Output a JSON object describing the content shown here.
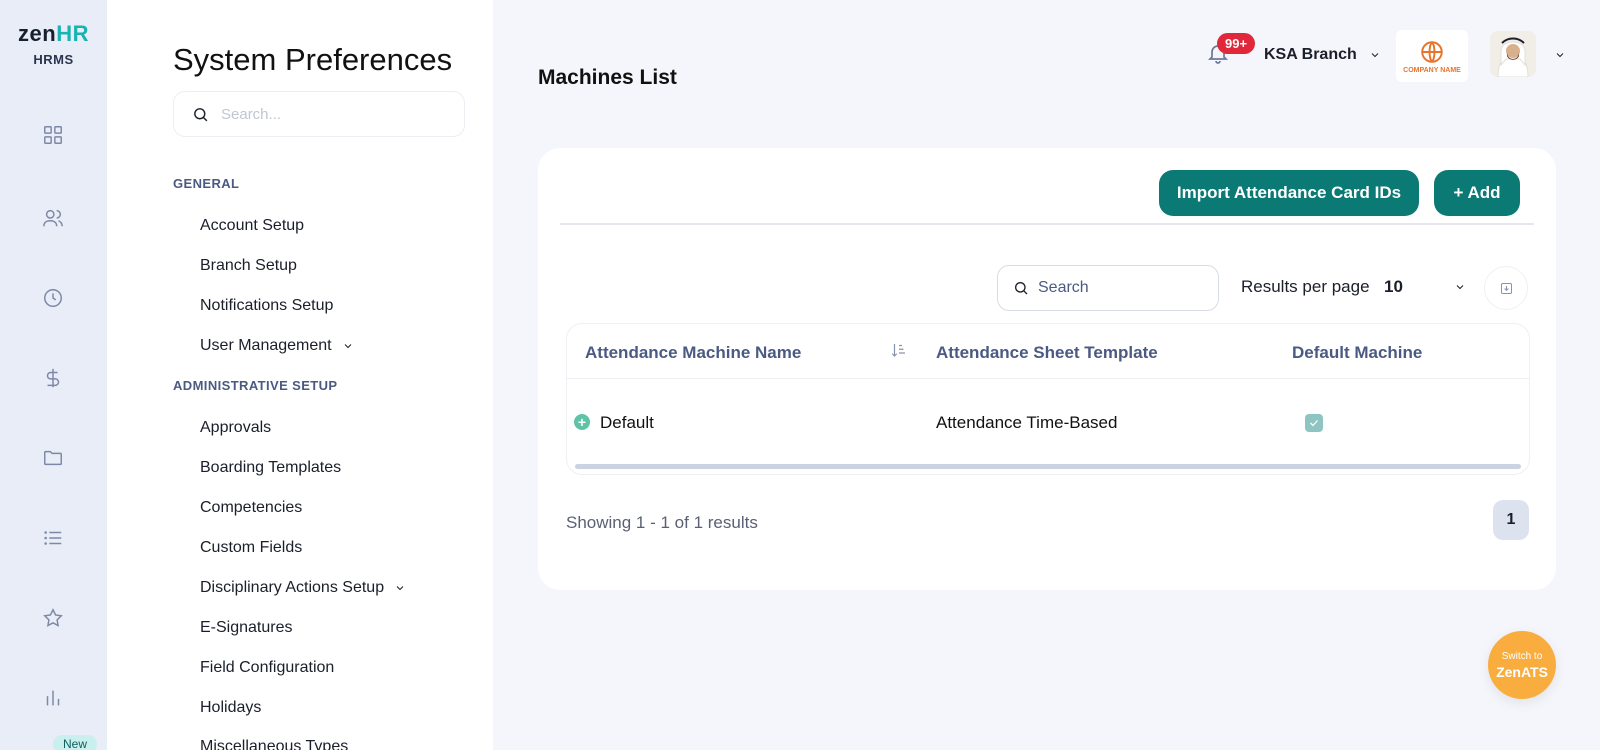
{
  "logo": {
    "brand_prefix": "zen",
    "brand_suffix": "HR",
    "subtitle": "HRMS"
  },
  "rail": {
    "icons": [
      "dashboard-icon",
      "people-icon",
      "clock-icon",
      "dollar-icon",
      "folder-icon",
      "list-icon",
      "star-icon",
      "chart-icon"
    ],
    "new_badge": "New"
  },
  "prefs": {
    "title": "System Preferences",
    "search_placeholder": "Search...",
    "sections": [
      {
        "label": "GENERAL",
        "items": [
          "Account Setup",
          "Branch Setup",
          "Notifications Setup",
          "User Management"
        ]
      },
      {
        "label": "ADMINISTRATIVE SETUP",
        "items": [
          "Approvals",
          "Boarding Templates",
          "Competencies",
          "Custom Fields",
          "Disciplinary Actions Setup",
          "E-Signatures",
          "Field Configuration",
          "Holidays",
          "Miscellaneous Types"
        ]
      }
    ]
  },
  "header": {
    "page_title": "Machines List",
    "notifications_badge": "99+",
    "branch": "KSA Branch",
    "company_logo_text": "COMPANY NAME"
  },
  "card": {
    "import_button": "Import Attendance Card IDs",
    "add_button": "+ Add",
    "search_placeholder": "Search",
    "results_per_page_label": "Results per page",
    "results_per_page_value": "10",
    "columns": [
      "Attendance Machine Name",
      "Attendance Sheet Template",
      "Default Machine"
    ],
    "rows": [
      {
        "name": "Default",
        "template": "Attendance Time-Based",
        "default": true
      }
    ],
    "showing": "Showing 1 - 1 of 1 results",
    "current_page": "1"
  },
  "zenats": {
    "line1": "Switch to",
    "line2": "ZenATS"
  },
  "colors": {
    "accent": "#0b7a75",
    "brand_hr": "#19b3b0",
    "badge": "#e0283a",
    "zenats": "#f9ad3f"
  }
}
